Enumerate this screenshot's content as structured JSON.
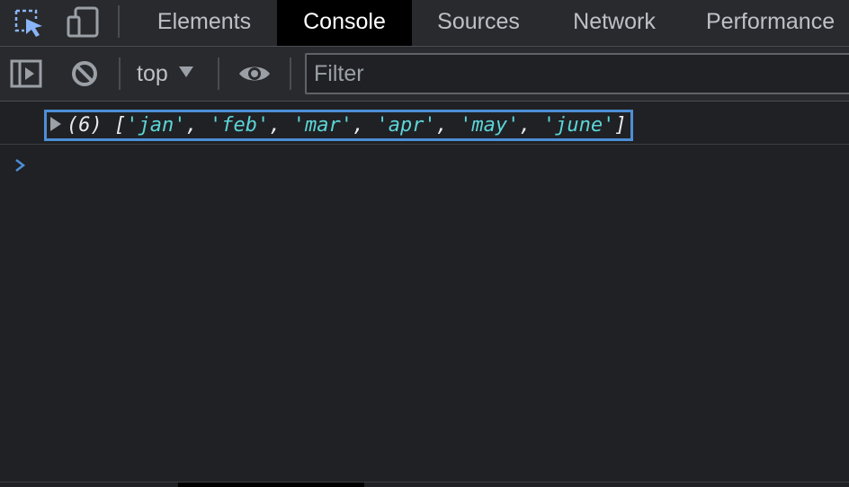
{
  "tabs": [
    {
      "label": "Elements",
      "active": false
    },
    {
      "label": "Console",
      "active": true
    },
    {
      "label": "Sources",
      "active": false
    },
    {
      "label": "Network",
      "active": false
    },
    {
      "label": "Performance",
      "active": false
    }
  ],
  "toolbar_icons": {
    "inspect": "inspect-element-icon",
    "device": "device-toolbar-icon",
    "sidebar": "console-sidebar-icon",
    "clear": "clear-console-icon",
    "live_expression": "eye-icon"
  },
  "console_toolbar": {
    "context_label": "top",
    "filter_placeholder": "Filter"
  },
  "log": {
    "count": "(6)",
    "open_bracket": "[",
    "close_bracket": "]",
    "separator": ", ",
    "items": [
      "'jan'",
      "'feb'",
      "'mar'",
      "'apr'",
      "'may'",
      "'june'"
    ]
  },
  "colors": {
    "active_tab_bg": "#000000",
    "accent": "#4d8fd6",
    "string": "#5cd5d8",
    "prompt": "#4d8fd6"
  }
}
